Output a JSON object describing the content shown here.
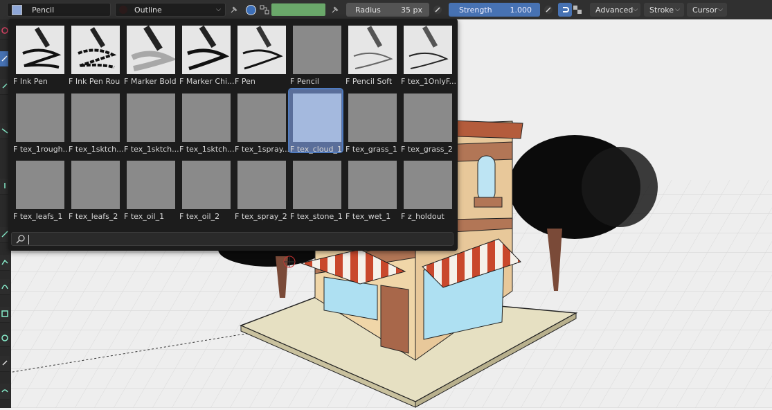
{
  "header": {
    "brush_name": "Pencil",
    "material_name": "Outline",
    "color_swatch": "#6aa86a",
    "radius_label": "Radius",
    "radius_value": "35 px",
    "strength_label": "Strength",
    "strength_value": "1.000",
    "menus": [
      "Advanced",
      "Stroke",
      "Cursor"
    ]
  },
  "brushes": [
    {
      "label": "F Ink Pen",
      "thumb": "ink-pen"
    },
    {
      "label": "F Ink Pen Rou",
      "thumb": "ink-pen-rough"
    },
    {
      "label": "F Marker Bold",
      "thumb": "marker-bold"
    },
    {
      "label": "F Marker Chi...",
      "thumb": "marker-chisel"
    },
    {
      "label": "F Pen",
      "thumb": "pen"
    },
    {
      "label": "F Pencil",
      "thumb": "blank"
    },
    {
      "label": "F Pencil Soft",
      "thumb": "pencil-soft"
    },
    {
      "label": "F tex_1OnlyF...",
      "thumb": "pencil"
    },
    {
      "label": "F tex_1rough...",
      "thumb": "blank"
    },
    {
      "label": "F tex_1sktch...",
      "thumb": "blank"
    },
    {
      "label": "F tex_1sktch...",
      "thumb": "blank"
    },
    {
      "label": "F tex_1sktch...",
      "thumb": "blank"
    },
    {
      "label": "F tex_1spray...",
      "thumb": "blank"
    },
    {
      "label": "F tex_cloud_1",
      "thumb": "blank"
    },
    {
      "label": "F tex_grass_1",
      "thumb": "blank"
    },
    {
      "label": "F tex_grass_2",
      "thumb": "blank"
    },
    {
      "label": "F tex_leafs_1",
      "thumb": "blank"
    },
    {
      "label": "F tex_leafs_2",
      "thumb": "blank"
    },
    {
      "label": "F tex_oil_1",
      "thumb": "blank"
    },
    {
      "label": "F tex_oil_2",
      "thumb": "blank"
    },
    {
      "label": "F tex_spray_2",
      "thumb": "blank"
    },
    {
      "label": "F tex_stone_1",
      "thumb": "blank"
    },
    {
      "label": "F tex_wet_1",
      "thumb": "blank"
    },
    {
      "label": "F z_holdout",
      "thumb": "blank"
    }
  ],
  "selected_brush": 13,
  "search": {
    "value": "",
    "placeholder": ""
  },
  "colors": {
    "header_bg": "#303030",
    "popup_bg": "#1c1c1c",
    "accent_blue": "#4772b3",
    "selection": "#5a6e9a"
  }
}
